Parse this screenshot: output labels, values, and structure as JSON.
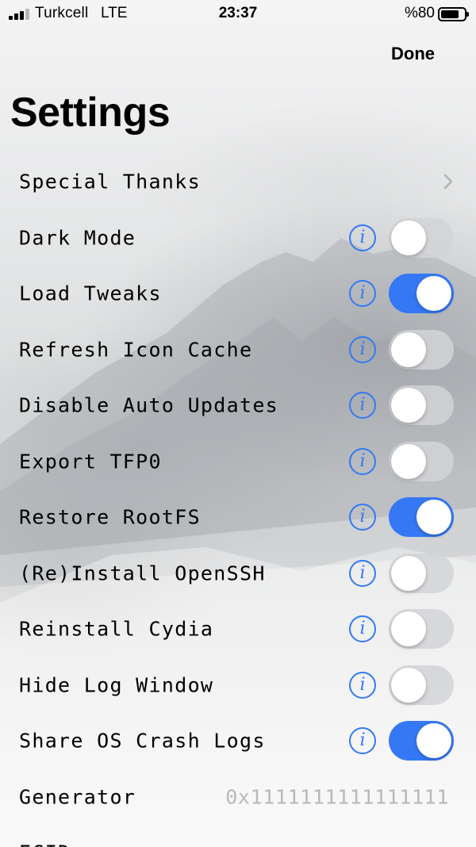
{
  "status_bar": {
    "carrier": "Turkcell",
    "network": "LTE",
    "time": "23:37",
    "battery_percent": "%80",
    "battery_level": 0.8,
    "signal_bars": 3
  },
  "nav": {
    "done_label": "Done",
    "title": "Settings"
  },
  "accent_color": "#3478f6",
  "rows": [
    {
      "label": "Special Thanks",
      "type": "disclosure",
      "icon": "chevron-right-icon"
    },
    {
      "label": "Dark Mode",
      "type": "toggle",
      "on": false
    },
    {
      "label": "Load Tweaks",
      "type": "toggle",
      "on": true
    },
    {
      "label": "Refresh Icon Cache",
      "type": "toggle",
      "on": false
    },
    {
      "label": "Disable Auto Updates",
      "type": "toggle",
      "on": false
    },
    {
      "label": "Export TFP0",
      "type": "toggle",
      "on": false
    },
    {
      "label": "Restore RootFS",
      "type": "toggle",
      "on": true
    },
    {
      "label": "(Re)Install OpenSSH",
      "type": "toggle",
      "on": false
    },
    {
      "label": "Reinstall Cydia",
      "type": "toggle",
      "on": false
    },
    {
      "label": "Hide Log Window",
      "type": "toggle",
      "on": false
    },
    {
      "label": "Share OS Crash Logs",
      "type": "toggle",
      "on": true
    },
    {
      "label": "Generator",
      "type": "value",
      "value": "0x1111111111111111"
    },
    {
      "label": "ECID",
      "type": "value",
      "value": ""
    }
  ]
}
